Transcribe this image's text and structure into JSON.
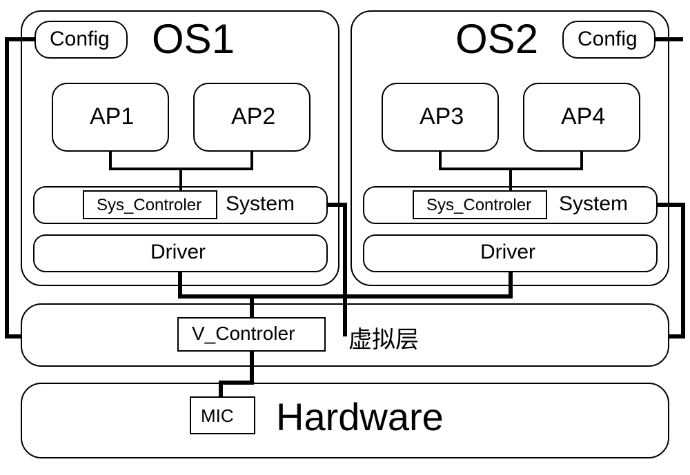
{
  "os1": {
    "title": "OS1",
    "config": "Config",
    "ap1": "AP1",
    "ap2": "AP2",
    "sys_controller": "Sys_Controler",
    "system": "System",
    "driver": "Driver"
  },
  "os2": {
    "title": "OS2",
    "config": "Config",
    "ap3": "AP3",
    "ap4": "AP4",
    "sys_controller": "Sys_Controler",
    "system": "System",
    "driver": "Driver"
  },
  "virtual_layer": {
    "v_controller": "V_Controler",
    "label": "虚拟层"
  },
  "hardware": {
    "mic": "MIC",
    "label": "Hardware"
  }
}
